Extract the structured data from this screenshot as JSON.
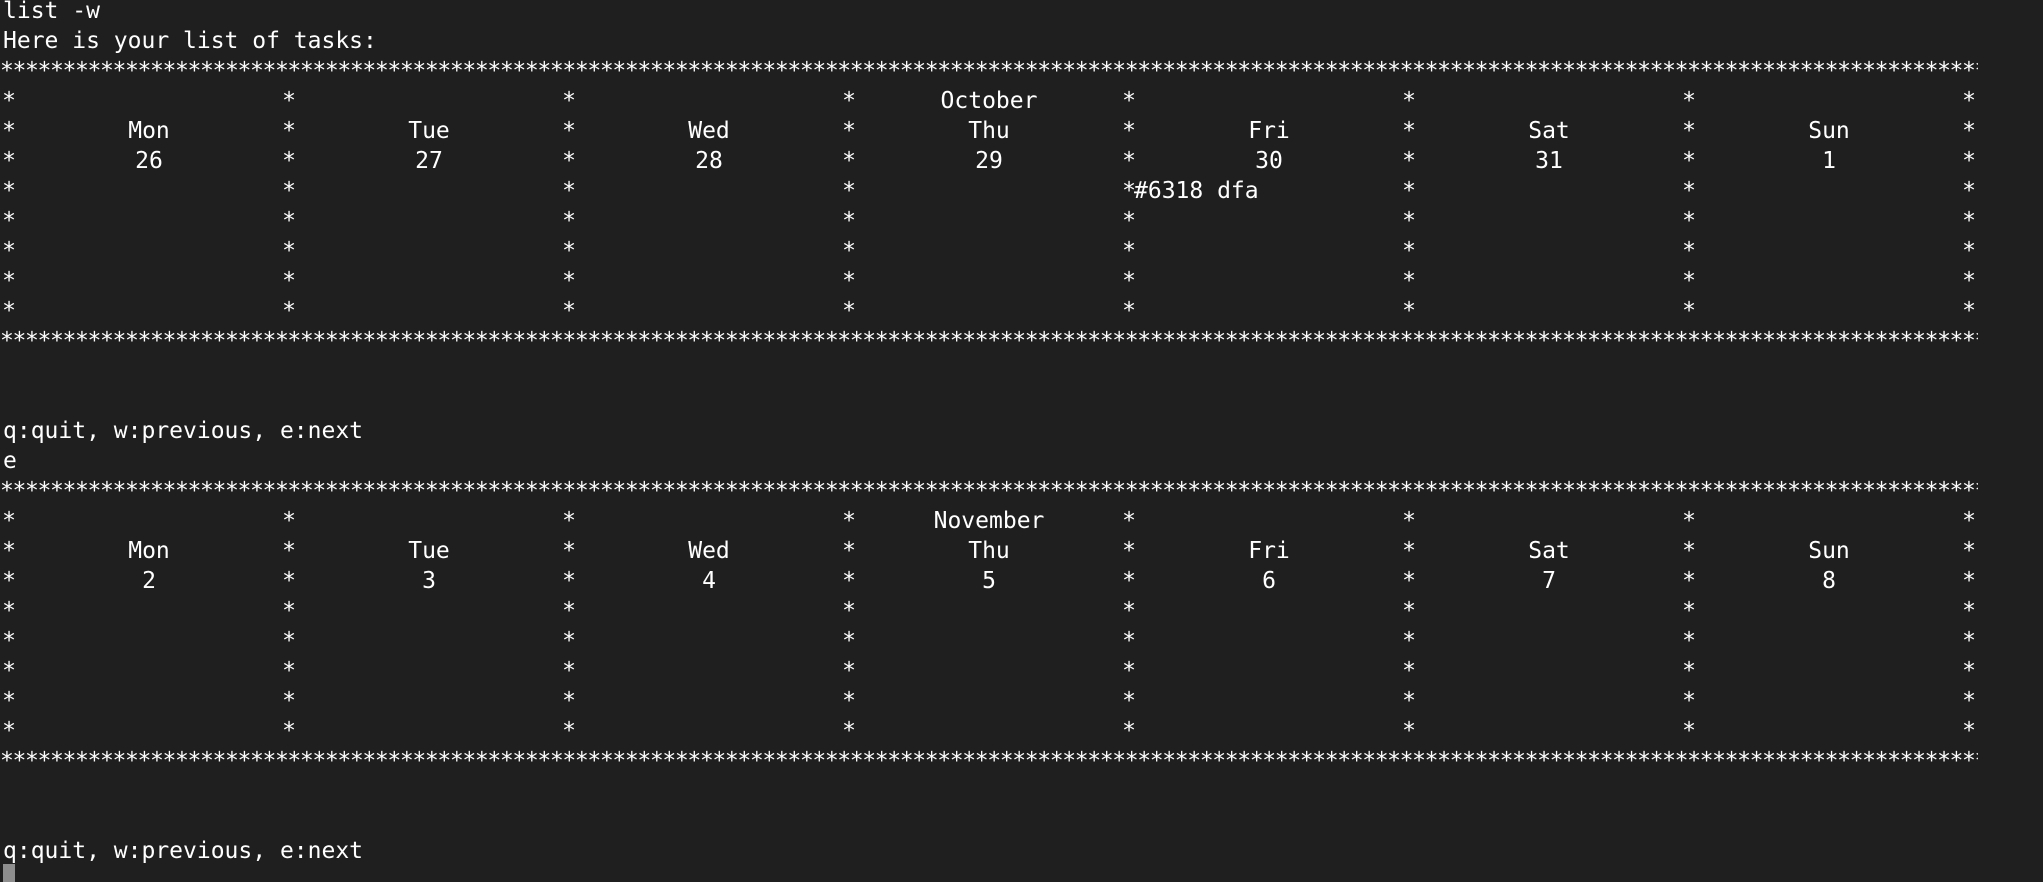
{
  "terminal": {
    "command": "list -w",
    "intro": "Here is your list of tasks:",
    "prompt": "q:quit, w:previous, e:next",
    "typed_key": "e",
    "border_char": "*"
  },
  "weeks": [
    {
      "month": "October",
      "days": [
        {
          "name": "Mon",
          "num": "26"
        },
        {
          "name": "Tue",
          "num": "27"
        },
        {
          "name": "Wed",
          "num": "28"
        },
        {
          "name": "Thu",
          "num": "29"
        },
        {
          "name": "Fri",
          "num": "30"
        },
        {
          "name": "Sat",
          "num": "31"
        },
        {
          "name": "Sun",
          "num": "1"
        }
      ],
      "tasks": [
        {
          "day_index": 4,
          "text": "#6318 dfa"
        }
      ]
    },
    {
      "month": "November",
      "days": [
        {
          "name": "Mon",
          "num": "2"
        },
        {
          "name": "Tue",
          "num": "3"
        },
        {
          "name": "Wed",
          "num": "4"
        },
        {
          "name": "Thu",
          "num": "5"
        },
        {
          "name": "Fri",
          "num": "6"
        },
        {
          "name": "Sat",
          "num": "7"
        },
        {
          "name": "Sun",
          "num": "8"
        }
      ],
      "tasks": []
    }
  ]
}
